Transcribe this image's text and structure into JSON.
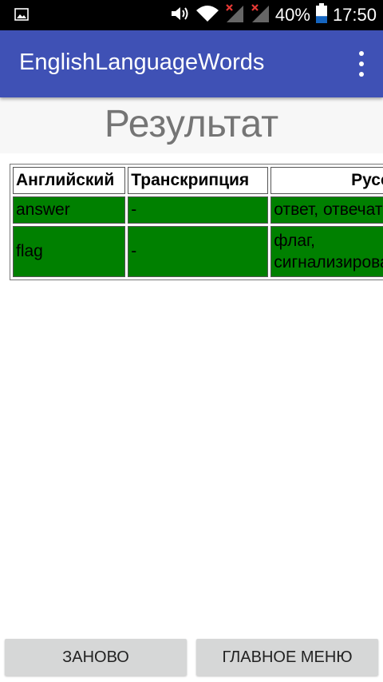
{
  "status_bar": {
    "battery_percent": "40%",
    "time": "17:50",
    "icons": [
      "gallery-notification-icon",
      "volume-icon",
      "wifi-icon",
      "signal-no-sim-icon",
      "signal-no-sim-icon",
      "battery-icon"
    ],
    "battery_level": 0.4
  },
  "app_bar": {
    "title": "EnglishLanguageWords",
    "menu_icon": "overflow-menu-icon",
    "color": "#3f51b5"
  },
  "result": {
    "title": "Результат"
  },
  "table": {
    "headers": [
      "Английский",
      "Транскрипция",
      "Русский"
    ],
    "rows": [
      {
        "english": "answer",
        "transcription": "-",
        "russian": "ответ, отвечать"
      },
      {
        "english": "flag",
        "transcription": "-",
        "russian": "флаг, сигнализировать"
      }
    ],
    "correct_color": "#008000"
  },
  "buttons": {
    "restart": "ЗАНОВО",
    "main_menu": "ГЛАВНОЕ МЕНЮ"
  }
}
